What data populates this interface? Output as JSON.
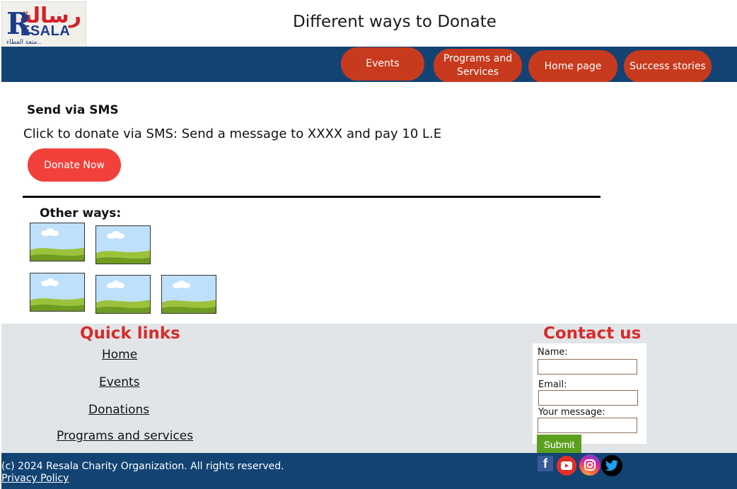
{
  "logo": {
    "arabic_text": "رسالة",
    "letter": "R",
    "english_text": "ESALA",
    "tagline": "متعة العطاء.."
  },
  "header": {
    "title": "Different ways to Donate"
  },
  "nav": {
    "items": [
      {
        "label": "Events"
      },
      {
        "label": "Programs and Services"
      },
      {
        "label": "Home page"
      },
      {
        "label": "Success stories"
      }
    ]
  },
  "main": {
    "sms_heading": "Send via SMS",
    "sms_text": "Click to donate via SMS: Send a message to XXXX and pay 10 L.E",
    "donate_button": "Donate Now",
    "other_heading": "Other ways:",
    "images": [
      "image-placeholder",
      "image-placeholder",
      "image-placeholder",
      "image-placeholder",
      "image-placeholder"
    ]
  },
  "footer": {
    "quick_links_title": "Quick links",
    "quick_links": [
      {
        "label": "Home"
      },
      {
        "label": "Events"
      },
      {
        "label": "Donations"
      },
      {
        "label": "Programs and services"
      }
    ],
    "contact_title": "Contact us",
    "form": {
      "name_label": "Name:",
      "email_label": "Email:",
      "message_label": "Your message:",
      "submit_label": "Submit"
    },
    "copyright": "(c) 2024 Resala Charity Organization. All rights reserved.",
    "privacy": "Privacy Policy",
    "social": [
      "facebook-icon",
      "youtube-icon",
      "instagram-icon",
      "twitter-icon"
    ]
  },
  "colors": {
    "nav_bg": "#124373",
    "nav_button": "#c83a1d",
    "donate_button": "#f2403b",
    "footer_title": "#d82b2b",
    "submit": "#5aa01e",
    "footer_bg": "#e2e5e8"
  }
}
